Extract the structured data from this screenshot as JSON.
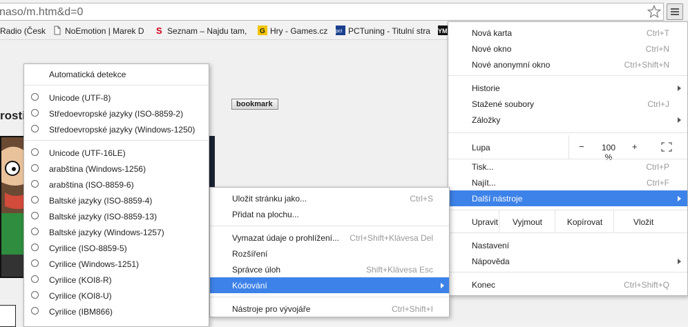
{
  "omnibox": {
    "url": "naso/m.htm&d=0"
  },
  "bookmarks": [
    {
      "label": "Radio (Česk",
      "icon": "radio-icon"
    },
    {
      "label": "NoEmotion | Marek D",
      "icon": "page-icon"
    },
    {
      "label": "Seznam – Najdu tam,",
      "icon": "seznam-icon"
    },
    {
      "label": "Hry - Games.cz",
      "icon": "games-icon"
    },
    {
      "label": "PCTuning - Titulní stra",
      "icon": "pctuning-icon"
    },
    {
      "label": "YM",
      "icon": "ym-icon"
    }
  ],
  "page": {
    "heading": "rosti",
    "bookmark_button": "bookmark"
  },
  "main_menu": {
    "items": [
      {
        "label": "Nová karta",
        "shortcut": "Ctrl+T"
      },
      {
        "label": "Nové okno",
        "shortcut": "Ctrl+N"
      },
      {
        "label": "Nové anonymní okno",
        "shortcut": "Ctrl+Shift+N"
      },
      {
        "label": "Historie",
        "shortcut": ""
      },
      {
        "label": "Stažené soubory",
        "shortcut": "Ctrl+J"
      },
      {
        "label": "Záložky",
        "shortcut": ""
      },
      {
        "label": "Tisk...",
        "shortcut": "Ctrl+P"
      },
      {
        "label": "Najít...",
        "shortcut": "Ctrl+F"
      },
      {
        "label": "Další nástroje",
        "shortcut": ""
      },
      {
        "label": "Nastavení",
        "shortcut": ""
      },
      {
        "label": "Nápověda",
        "shortcut": ""
      },
      {
        "label": "Konec",
        "shortcut": "Ctrl+Shift+Q"
      }
    ],
    "zoom": {
      "label": "Lupa",
      "minus": "−",
      "value": "100 %",
      "plus": "+"
    },
    "edit": {
      "label": "Upravit",
      "cut": "Vyjmout",
      "copy": "Kopírovat",
      "paste": "Vložit"
    }
  },
  "tools_menu": {
    "items": [
      {
        "label": "Uložit stránku jako...",
        "shortcut": "Ctrl+S"
      },
      {
        "label": "Přidat na plochu...",
        "shortcut": ""
      },
      {
        "label": "Vymazat údaje o prohlížení...",
        "shortcut": "Ctrl+Shift+Klávesa Del"
      },
      {
        "label": "Rozšíření",
        "shortcut": ""
      },
      {
        "label": "Správce úloh",
        "shortcut": "Shift+Klávesa Esc"
      },
      {
        "label": "Kódování",
        "shortcut": ""
      },
      {
        "label": "Nástroje pro vývojáře",
        "shortcut": "Ctrl+Shift+I"
      }
    ]
  },
  "encoding_menu": {
    "auto": "Automatická detekce",
    "items": [
      "Unicode (UTF-8)",
      "Středoevropské jazyky (ISO-8859-2)",
      "Středoevropské jazyky (Windows-1250)",
      "Unicode (UTF-16LE)",
      "arabština (Windows-1256)",
      "arabština (ISO-8859-6)",
      "Baltské jazyky (ISO-8859-4)",
      "Baltské jazyky (ISO-8859-13)",
      "Baltské jazyky (Windows-1257)",
      "Cyrilice (ISO-8859-5)",
      "Cyrilice (Windows-1251)",
      "Cyrilice (KOI8-R)",
      "Cyrilice (KOI8-U)",
      "Cyrilice (IBM866)"
    ]
  },
  "colors": {
    "highlight": "#3d82e8"
  }
}
